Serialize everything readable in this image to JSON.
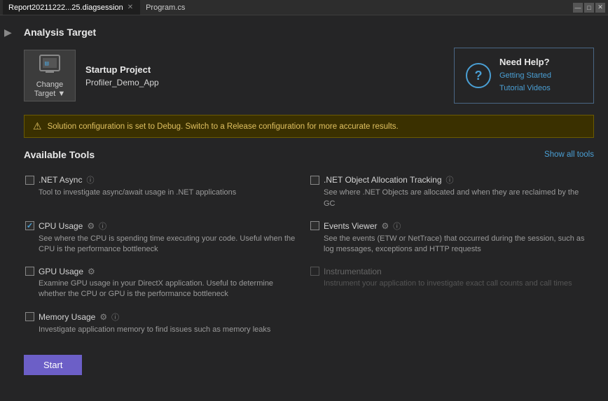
{
  "titlebar": {
    "tabs": [
      {
        "id": "diag",
        "label": "Report20211222...25.diagsession",
        "active": true,
        "closable": true
      },
      {
        "id": "program",
        "label": "Program.cs",
        "active": false,
        "closable": false
      }
    ],
    "controls": [
      "—",
      "□",
      "✕"
    ]
  },
  "main": {
    "section_title": "Analysis Target",
    "change_target": {
      "label": "Change\nTarget",
      "dropdown": "▼"
    },
    "startup_project": {
      "label": "Startup Project",
      "name": "Profiler_Demo_App"
    },
    "help": {
      "title": "Need Help?",
      "link1": "Getting Started",
      "link2": "Tutorial Videos"
    },
    "warning": "Solution configuration is set to Debug. Switch to a Release configuration for more accurate results.",
    "available_tools_title": "Available Tools",
    "show_all_tools": "Show all tools",
    "tools": [
      {
        "id": "dotnet-async",
        "name": ".NET Async",
        "checked": false,
        "disabled": false,
        "has_info": true,
        "has_gear": false,
        "desc": "Tool to investigate async/await usage in .NET applications"
      },
      {
        "id": "dotnet-object-allocation",
        "name": ".NET Object Allocation Tracking",
        "checked": false,
        "disabled": false,
        "has_info": true,
        "has_gear": false,
        "desc": "See where .NET Objects are allocated and when they are reclaimed by the GC"
      },
      {
        "id": "cpu-usage",
        "name": "CPU Usage",
        "checked": true,
        "disabled": false,
        "has_info": true,
        "has_gear": true,
        "desc": "See where the CPU is spending time executing your code. Useful when the CPU is the performance bottleneck"
      },
      {
        "id": "events-viewer",
        "name": "Events Viewer",
        "checked": false,
        "disabled": false,
        "has_info": true,
        "has_gear": true,
        "desc": "See the events (ETW or NetTrace) that occurred during the session, such as log messages, exceptions and HTTP requests"
      },
      {
        "id": "gpu-usage",
        "name": "GPU Usage",
        "checked": false,
        "disabled": false,
        "has_info": false,
        "has_gear": true,
        "desc": "Examine GPU usage in your DirectX application. Useful to determine whether the CPU or GPU is the performance bottleneck"
      },
      {
        "id": "instrumentation",
        "name": "Instrumentation",
        "checked": false,
        "disabled": true,
        "has_info": false,
        "has_gear": false,
        "desc": "Instrument your application to investigate exact call counts and call times"
      },
      {
        "id": "memory-usage",
        "name": "Memory Usage",
        "checked": false,
        "disabled": false,
        "has_info": true,
        "has_gear": true,
        "desc": "Investigate application memory to find issues such as memory leaks"
      }
    ],
    "start_button": "Start"
  }
}
